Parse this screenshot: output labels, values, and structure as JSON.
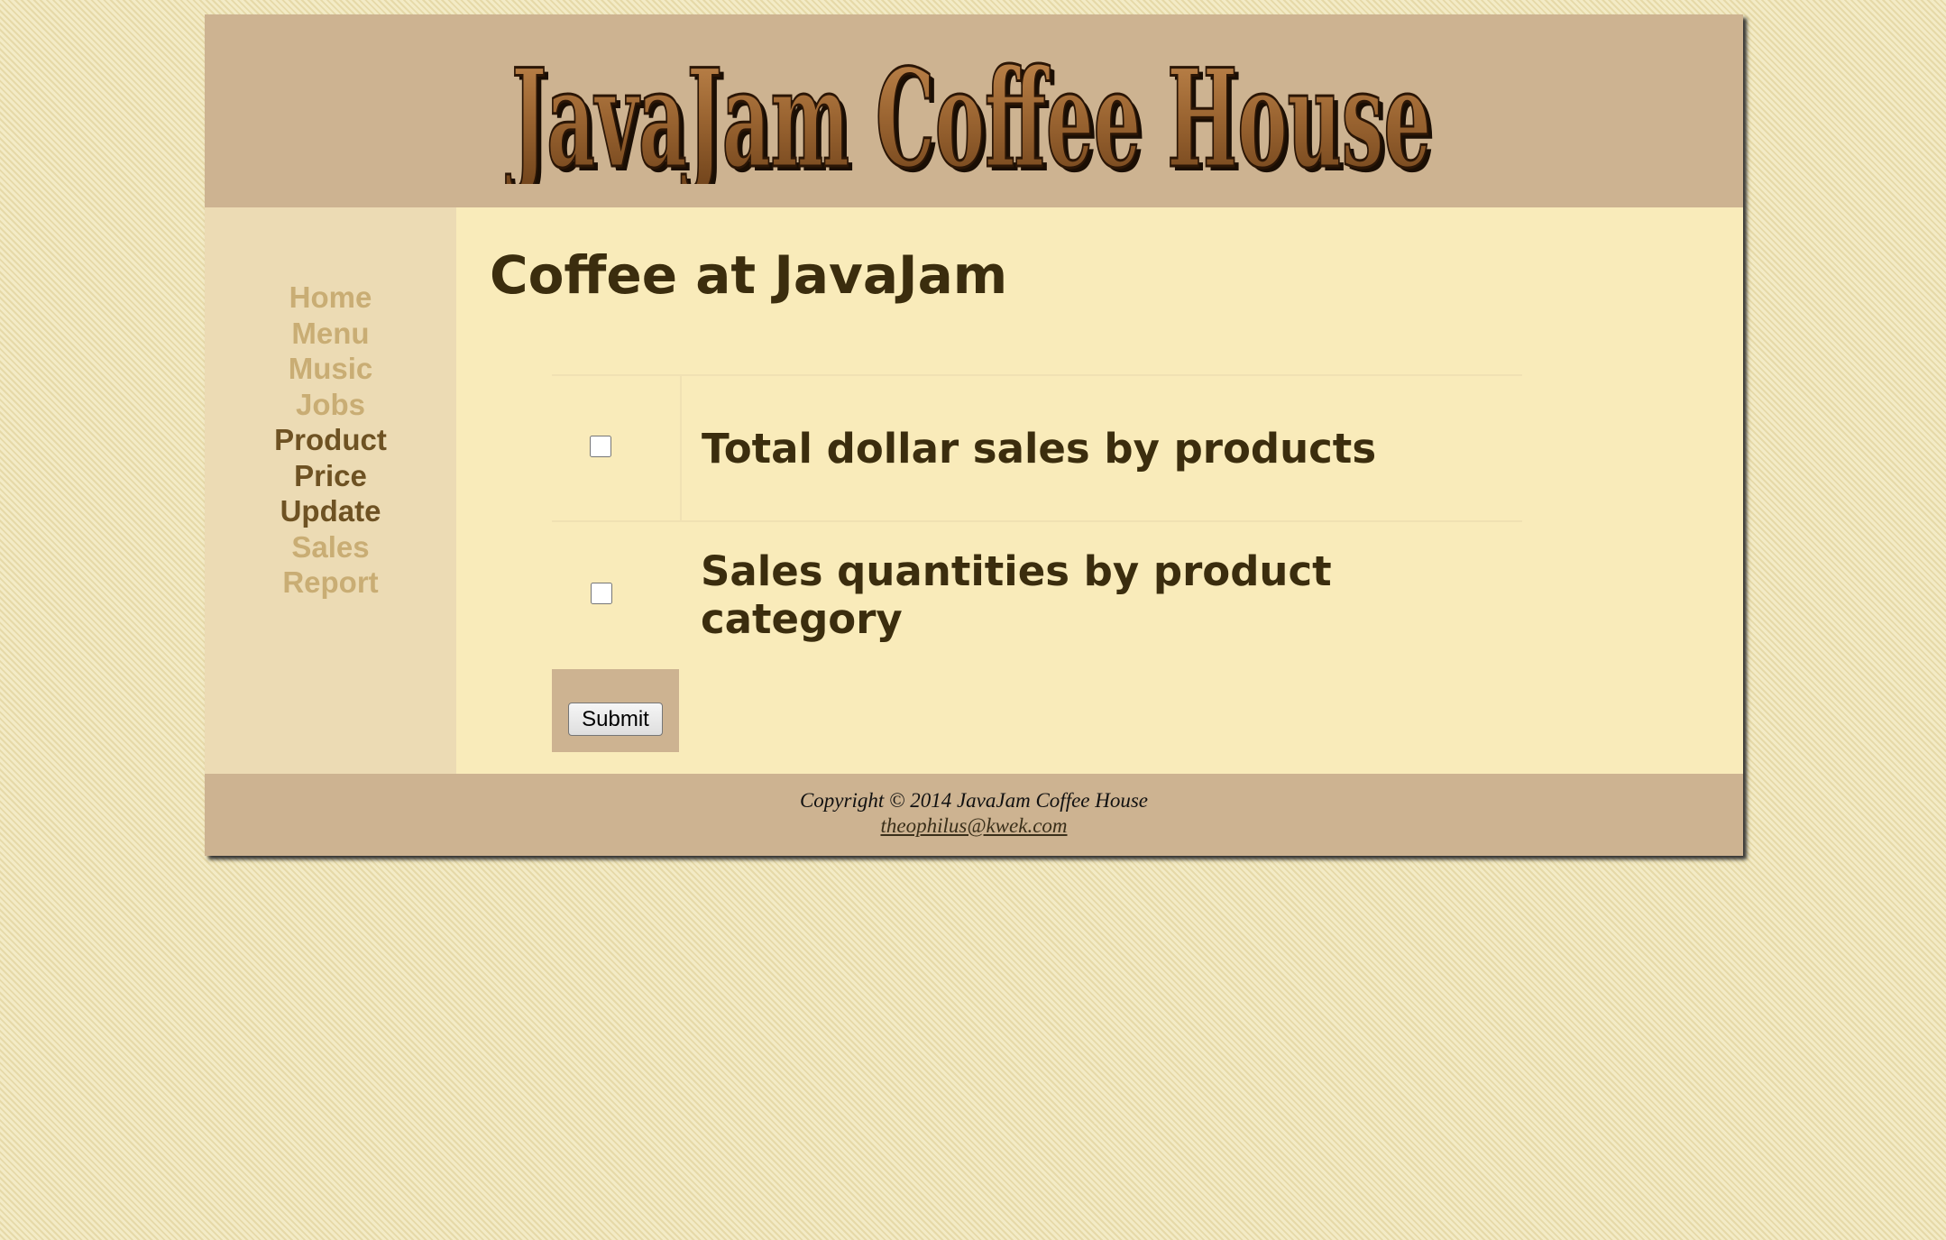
{
  "header": {
    "logo_text": "JavaJam Coffee House"
  },
  "nav": {
    "items": [
      {
        "label": "Home"
      },
      {
        "label": "Menu"
      },
      {
        "label": "Music"
      },
      {
        "label": "Jobs"
      },
      {
        "label": "Product",
        "current": true
      },
      {
        "label": "Price",
        "current": true
      },
      {
        "label": "Update",
        "current": true
      },
      {
        "label": "Sales"
      },
      {
        "label": "Report"
      }
    ]
  },
  "main": {
    "title": "Coffee at JavaJam",
    "options": [
      {
        "label": "Total dollar sales by products",
        "checked": false
      },
      {
        "label": "Sales quantities by product category",
        "checked": false
      }
    ],
    "submit_label": "Submit"
  },
  "footer": {
    "copyright": "Copyright © 2014 JavaJam Coffee House",
    "email": "theophilus@kwek.com"
  },
  "colors": {
    "header_bg": "#cdb391",
    "content_bg": "#f9ebba",
    "nav_bg": "#ecdbb4",
    "nav_link": "#c9ad74",
    "nav_link_current": "#6e5223",
    "heading_text": "#3b2d0e"
  }
}
